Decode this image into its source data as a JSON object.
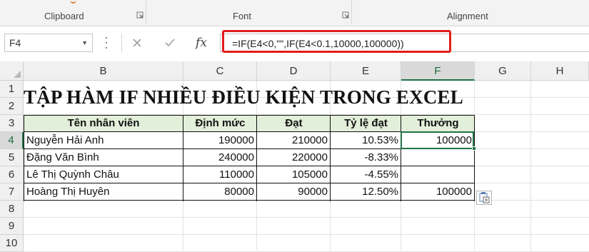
{
  "ribbon": {
    "groups": [
      {
        "label": "Clipboard"
      },
      {
        "label": "Font"
      },
      {
        "label": "Alignment"
      }
    ]
  },
  "formula_bar": {
    "name_box": "F4",
    "cancel_icon": "close-icon",
    "enter_icon": "check-icon",
    "fx_label": "fx",
    "formula": "=IF(E4<0,\"\",IF(E4<0.1,10000,100000))",
    "highlight_color": "#e11d1d"
  },
  "grid": {
    "columns": [
      "B",
      "C",
      "D",
      "E",
      "F",
      "G",
      "H"
    ],
    "rows": [
      "1",
      "2",
      "3",
      "4",
      "5",
      "6",
      "7",
      "8",
      "9",
      "10"
    ],
    "active_cell": "F4",
    "accent_color": "#217346",
    "header_fill": "#e2efda"
  },
  "sheet": {
    "title": "TẬP HÀM IF NHIỀU ĐIỀU KIỆN TRONG EXCEL",
    "table": {
      "headers": [
        "Tên nhân viên",
        "Định mức",
        "Đạt",
        "Tỷ lệ đạt",
        "Thưởng"
      ],
      "rows": [
        [
          "Nguyễn Hải Anh",
          "190000",
          "210000",
          "10.53%",
          "100000"
        ],
        [
          "Đặng Văn Bình",
          "240000",
          "220000",
          "-8.33%",
          ""
        ],
        [
          "Lê Thị Quỳnh Châu",
          "110000",
          "105000",
          "-4.55%",
          ""
        ],
        [
          "Hoàng Thị Huyên",
          "80000",
          "90000",
          "12.50%",
          "100000"
        ]
      ]
    }
  }
}
